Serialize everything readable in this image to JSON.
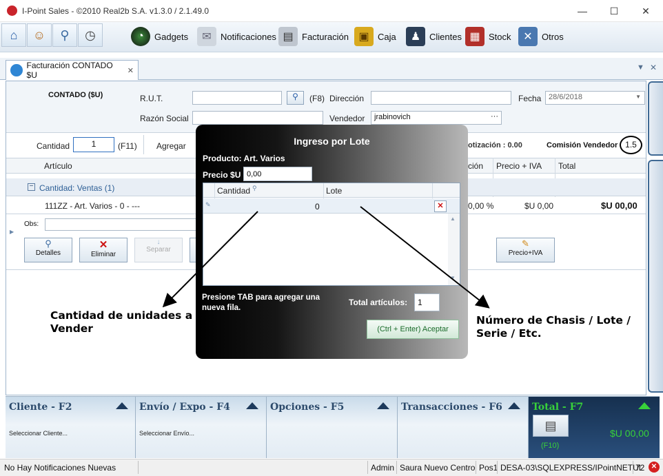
{
  "window": {
    "title": "I-Point Sales  - ©2010 Real2b S.A. v1.3.0 / 2.1.49.0",
    "min": "—",
    "max": "☐",
    "close": "✕"
  },
  "quick": [
    "⌂",
    "☺",
    "⚲",
    "◷"
  ],
  "menu": {
    "gadgets": "Gadgets",
    "notificaciones": "Notificaciones",
    "facturacion": "Facturación",
    "caja": "Caja",
    "clientes": "Clientes",
    "stock": "Stock",
    "otros": "Otros"
  },
  "tab": {
    "label": "Facturación CONTADO $U",
    "close": "✕"
  },
  "form": {
    "type_label": "CONTADO ($U)",
    "rut_label": "R.U.T.",
    "rut_value": "",
    "f8": "(F8)",
    "direccion_label": "Dirección",
    "direccion_value": "",
    "fecha_label": "Fecha",
    "fecha_value": "28/6/2018",
    "razon_label": "Razón Social",
    "razon_value": "",
    "vendedor_label": "Vendedor",
    "vendedor_value": "jrabinovich",
    "vendedor_btn": "···"
  },
  "qtybar": {
    "cantidad_label": "Cantidad",
    "cantidad_value": "1",
    "f11": "(F11)",
    "agregar_label": "Agregar",
    "cotizacion": "otización  : 0.00",
    "comision_label": "Comisión Vendedor",
    "comision_value": "1.5"
  },
  "grid": {
    "h_articulo": "Artículo",
    "h_ocion": "ción",
    "h_precio": "Precio + IVA",
    "h_total": "Total",
    "group": "Cantidad: Ventas (1)",
    "row_item": "111ZZ - Art. Varios - 0 - ---",
    "row_pct": "0,00 %",
    "row_precio": "$U 0,00",
    "row_total": "$U 00,00",
    "obs_label": "Obs:"
  },
  "actions": {
    "detalles": "Detalles",
    "eliminar": "Eliminar",
    "separar": "Separar",
    "precio_iva": "Precio+IVA"
  },
  "modal": {
    "title": "Ingreso por Lote",
    "producto": "Producto: Art. Varios",
    "precio_label": "Precio $U",
    "precio_value": "0,00",
    "col_cantidad": "Cantidad",
    "col_lote": "Lote",
    "row_cantidad": "0",
    "row_lote": "",
    "hint": "Presione TAB para agregar una nueva fila.",
    "total_label": "Total artículos:",
    "total_value": "1",
    "accept": "(Ctrl + Enter) Aceptar"
  },
  "annotations": {
    "left": "Cantidad de unidades a Vender",
    "right": "Número de Chasis / Lote / Serie / Etc."
  },
  "panels": {
    "cliente_title": "Cliente - F2",
    "cliente_sub": "Seleccionar Cliente...",
    "envio_title": "Envío / Expo - F4",
    "envio_sub": "Seleccionar Envío...",
    "opciones_title": "Opciones - F5",
    "trans_title": "Transacciones - F6",
    "total_title": "Total - F7",
    "total_value": "$U 00,00",
    "total_key": "(F10)"
  },
  "status": {
    "notif": "No Hay Notificaciones Nuevas",
    "user": "Admin",
    "branch": "Saura Nuevo Centro",
    "pos": "Pos1",
    "server": "DESA-03\\SQLEXPRESS/IPointNETUL",
    "num": "72"
  },
  "colors": {
    "accent": "#1d3a5c",
    "total_green": "#38d23a",
    "delete_red": "#cc1111"
  }
}
